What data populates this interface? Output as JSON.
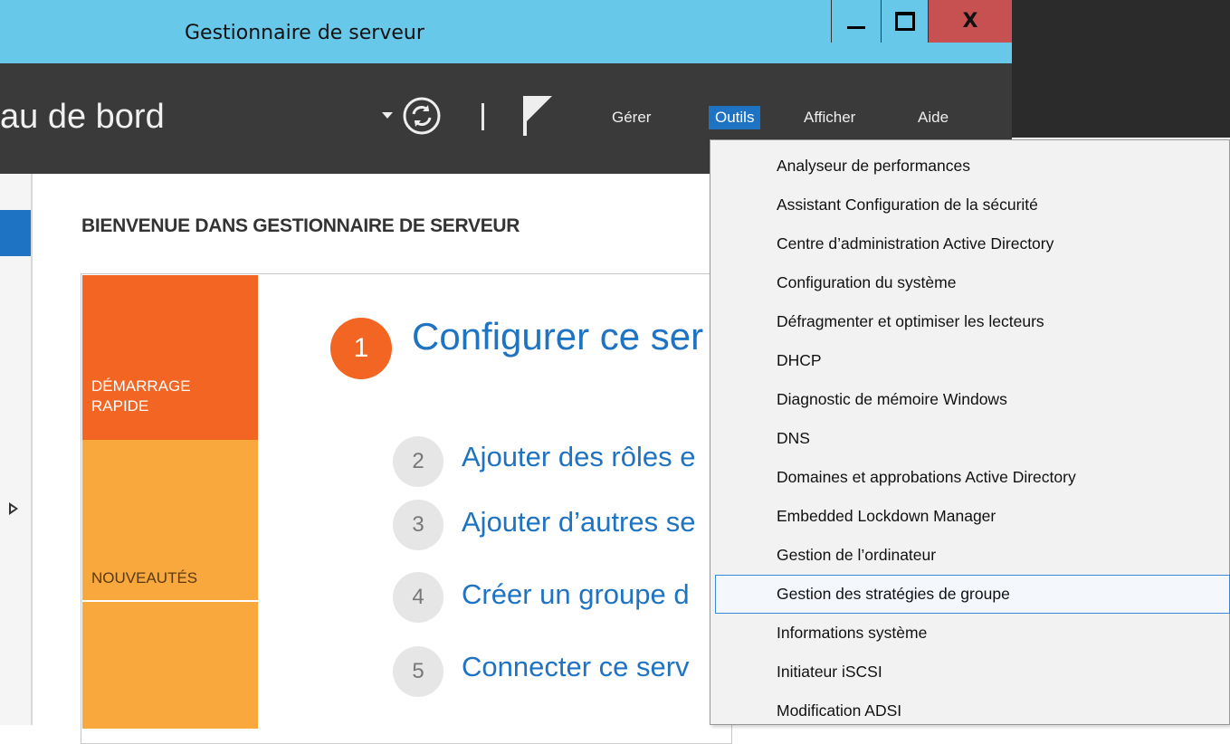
{
  "window": {
    "title": "Gestionnaire de serveur",
    "minimize_glyph": "",
    "maximize_glyph": "",
    "close_glyph": "X"
  },
  "header": {
    "title": "au de bord",
    "menus": [
      {
        "label": "Gérer"
      },
      {
        "label": "Outils"
      },
      {
        "label": "Afficher"
      },
      {
        "label": "Aide"
      }
    ]
  },
  "welcome": {
    "title": "BIENVENUE DANS GESTIONNAIRE DE SERVEUR",
    "tiles": [
      {
        "label": "DÉMARRAGE RAPIDE"
      },
      {
        "label": "NOUVEAUTÉS"
      }
    ],
    "steps": [
      {
        "number": "1",
        "label": "Configurer ce ser"
      },
      {
        "number": "2",
        "label": "Ajouter des rôles e"
      },
      {
        "number": "3",
        "label": "Ajouter d’autres se"
      },
      {
        "number": "4",
        "label": "Créer un groupe d"
      },
      {
        "number": "5",
        "label": "Connecter ce serv"
      }
    ]
  },
  "tools_menu": {
    "highlighted_index": 11,
    "items": [
      "Analyseur de performances",
      "Assistant Configuration de la sécurité",
      "Centre d’administration Active Directory",
      "Configuration du système",
      "Défragmenter et optimiser les lecteurs",
      "DHCP",
      "Diagnostic de mémoire Windows",
      "DNS",
      "Domaines et approbations Active Directory",
      "Embedded Lockdown Manager",
      "Gestion de l’ordinateur",
      "Gestion des stratégies de groupe",
      "Informations système",
      "Initiateur iSCSI",
      "Modification ADSI"
    ]
  },
  "colors": {
    "titlebar": "#68c8ea",
    "header": "#3a3a3a",
    "accent": "#1e73c2",
    "quickstart_tile": "#f26522",
    "whatsnew_tile": "#f9a83e",
    "close_button": "#c75050"
  }
}
